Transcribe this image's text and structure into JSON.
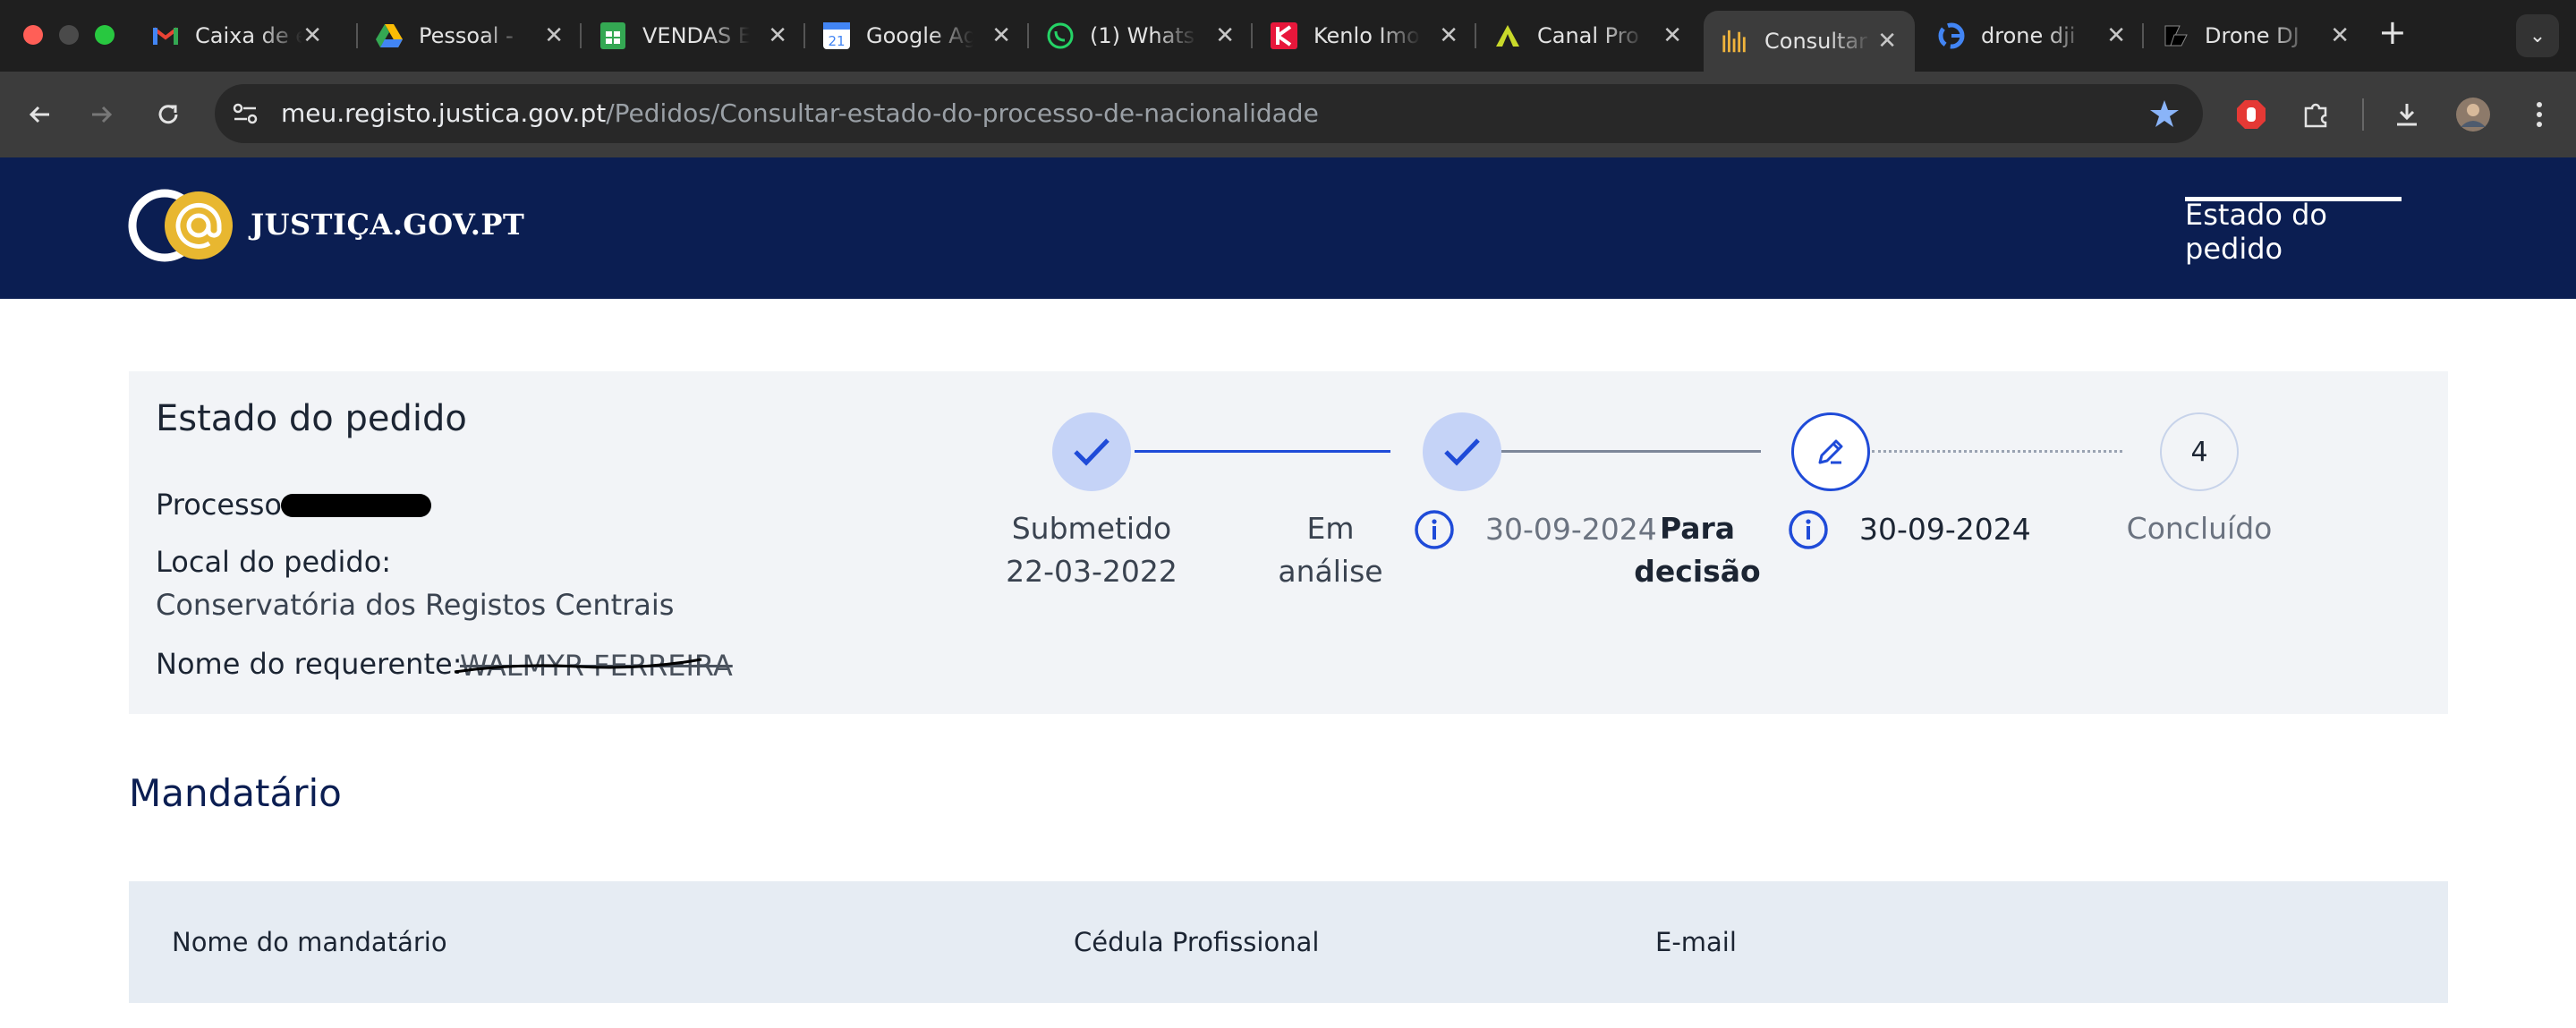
{
  "browser": {
    "tabs": [
      {
        "title": "Caixa de e",
        "icon": "gmail-icon"
      },
      {
        "title": "Pessoal - ",
        "icon": "google-drive-icon"
      },
      {
        "title": "VENDAS E",
        "icon": "google-sheets-icon"
      },
      {
        "title": "Google Ag",
        "icon": "google-calendar-icon"
      },
      {
        "title": "(1) Whats",
        "icon": "whatsapp-icon"
      },
      {
        "title": "Kenlo Imo",
        "icon": "kenlo-icon"
      },
      {
        "title": "Canal Pro",
        "icon": "canal-pro-icon"
      },
      {
        "title": "Consultar",
        "icon": "justica-icon",
        "active": true
      },
      {
        "title": "drone dji",
        "icon": "google-icon"
      },
      {
        "title": "Drone DJ",
        "icon": "drone-dj-icon"
      }
    ],
    "url_host": "meu.registo.justica.gov.pt",
    "url_path": "/Pedidos/Consultar-estado-do-processo-de-nacionalidade"
  },
  "site": {
    "brand": "JUSTIÇA.GOV.PT",
    "nav_link": "Estado do pedido"
  },
  "status_card": {
    "title": "Estado do pedido",
    "processo_label": "Processo:",
    "local_label": "Local do pedido:",
    "local_value": "Conservatória dos Registos Centrais",
    "requerente_label": "Nome do requerente:",
    "requerente_value": "WALMYR FERREIRA"
  },
  "steps": [
    {
      "label_line1": "Submetido",
      "label_line2": "22-03-2022",
      "state": "done"
    },
    {
      "label_line1": "Em",
      "label_line2": "análise",
      "date": "30-09-2024",
      "state": "done"
    },
    {
      "label_line1": "Para",
      "label_line2": "decisão",
      "date": "30-09-2024",
      "state": "current"
    },
    {
      "label_line1": "Concluído",
      "number": "4",
      "state": "pending"
    }
  ],
  "mandatario": {
    "title": "Mandatário",
    "columns": [
      "Nome do mandatário",
      "Cédula Profissional",
      "E-mail"
    ]
  },
  "colors": {
    "header_bg": "#0b1e52",
    "accent_blue": "#1f4bd8",
    "done_circle": "#c5d3f7",
    "card_bg": "#f2f4f7"
  }
}
